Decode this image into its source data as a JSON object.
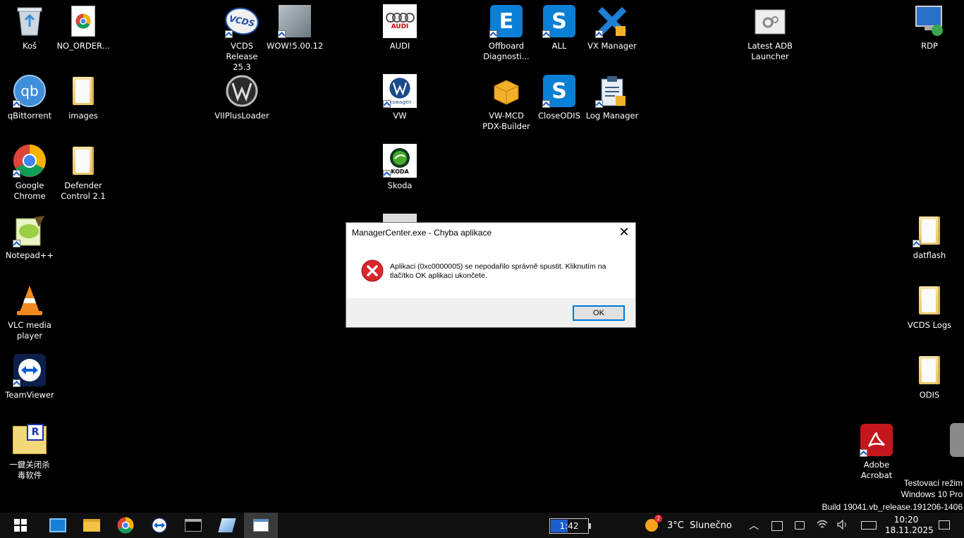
{
  "desktop_icons": {
    "recycle_bin": "Koš",
    "no_order": "NO_ORDER...",
    "vcds": "VCDS Release\n25.3",
    "wow": "WOW!5.00.12",
    "audi": "AUDI",
    "offboard": "Offboard\nDiagnosti...",
    "all": "ALL",
    "vx_manager": "VX Manager",
    "adb_launcher": "Latest ADB\nLauncher",
    "rdp": "RDP",
    "qbittorrent": "qBittorrent",
    "images": "images",
    "viiplus": "VIIPlusLoader",
    "vw": "VW",
    "vw_mcd": "VW-MCD\nPDX-Builder",
    "close_odis": "CloseODIS",
    "log_manager": "Log Manager",
    "chrome": "Google\nChrome",
    "defender": "Defender\nControl 2.1",
    "skoda": "Skoda",
    "notepadpp": "Notepad++",
    "datflash": "datflash",
    "vlc": "VLC media\nplayer",
    "vcds_logs": "VCDS Logs",
    "teamviewer": "TeamViewer",
    "odis": "ODIS",
    "chinese_tool": "一鍵关闭杀\n毒软件",
    "adobe": "Adobe\nAcrobat"
  },
  "icon_text": {
    "audi_brand": "AUDI",
    "vw_brand": "lkswagen",
    "skoda_brand": "KODA",
    "vcds_brand": "VCDS",
    "qb_brand": "qb"
  },
  "dialog": {
    "title": "ManagerCenter.exe - Chyba aplikace",
    "close_glyph": "✕",
    "message": "Aplikaci (0xc0000005) se nepodařilo správně spustit. Kliknutím na tlačítko OK aplikaci ukončete.",
    "ok_label": "OK"
  },
  "watermark": {
    "line1": "Testovací režim",
    "line2": "Windows 10 Pro",
    "line3": "Build 19041.vb_release.191206-1406"
  },
  "taskbar": {
    "battery_time": "1:42",
    "weather_badge": "2",
    "weather_text": "3°C  Slunečno",
    "time": "10:20",
    "date": "18.11.2025"
  },
  "colors": {
    "desktop_bg": "#000000",
    "odis_blue": "#0a7fd6",
    "error_red": "#d9262c"
  }
}
